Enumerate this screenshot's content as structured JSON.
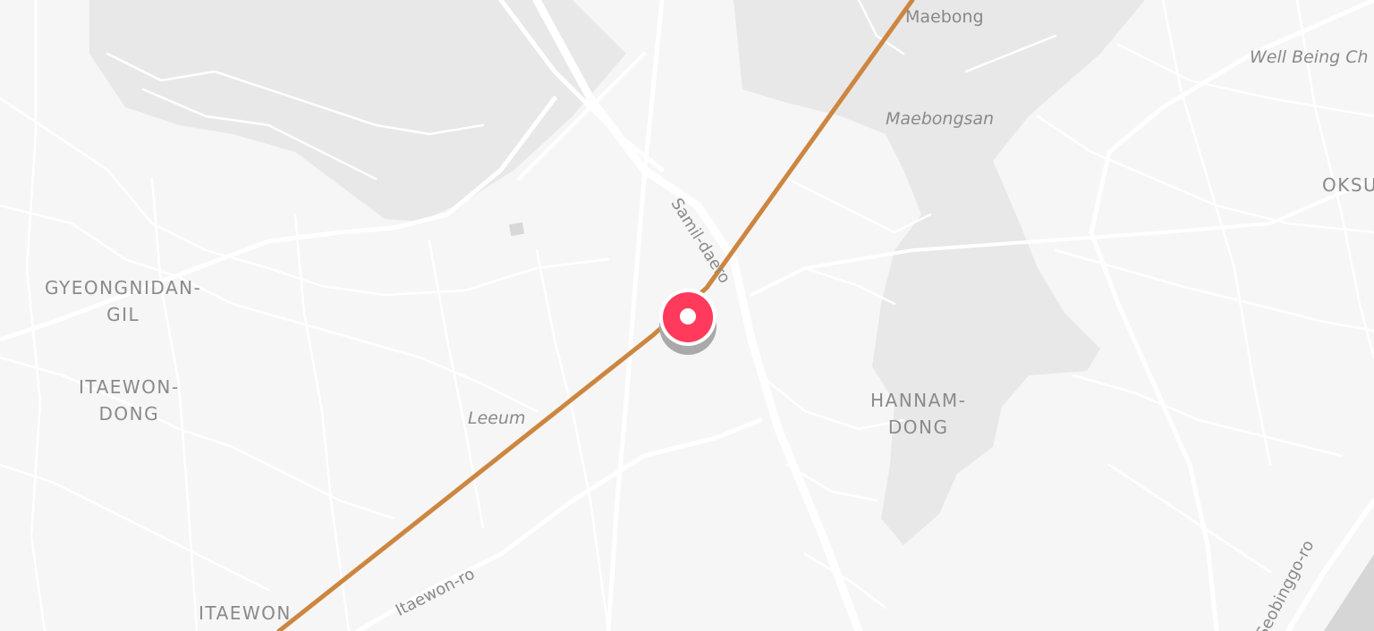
{
  "map": {
    "colors": {
      "background": "#f6f6f6",
      "park": "#e7e7e7",
      "road": "#ffffff",
      "route": "#cd8640",
      "marker": "#ff3a5c",
      "label": "#8e8e8e"
    },
    "districts": {
      "gyeongnidan": "GYEONGNIDAN-\nGIL",
      "itaewon_dong": "ITAEWON-\nDONG",
      "itaewon": "ITAEWON",
      "hannam": "HANNAM-\nDONG",
      "oksu": "OKSU"
    },
    "places": {
      "maebong": "Maebong",
      "maebongsan": "Maebongsan",
      "leeum": "Leeum",
      "well_being": "Well Being Ch"
    },
    "roads": {
      "samil": "Samil-daero",
      "itaewon_ro": "Itaewon-ro",
      "dongho": "Seobinggo-ro"
    },
    "marker": {
      "icon": "location-pin-icon"
    }
  }
}
